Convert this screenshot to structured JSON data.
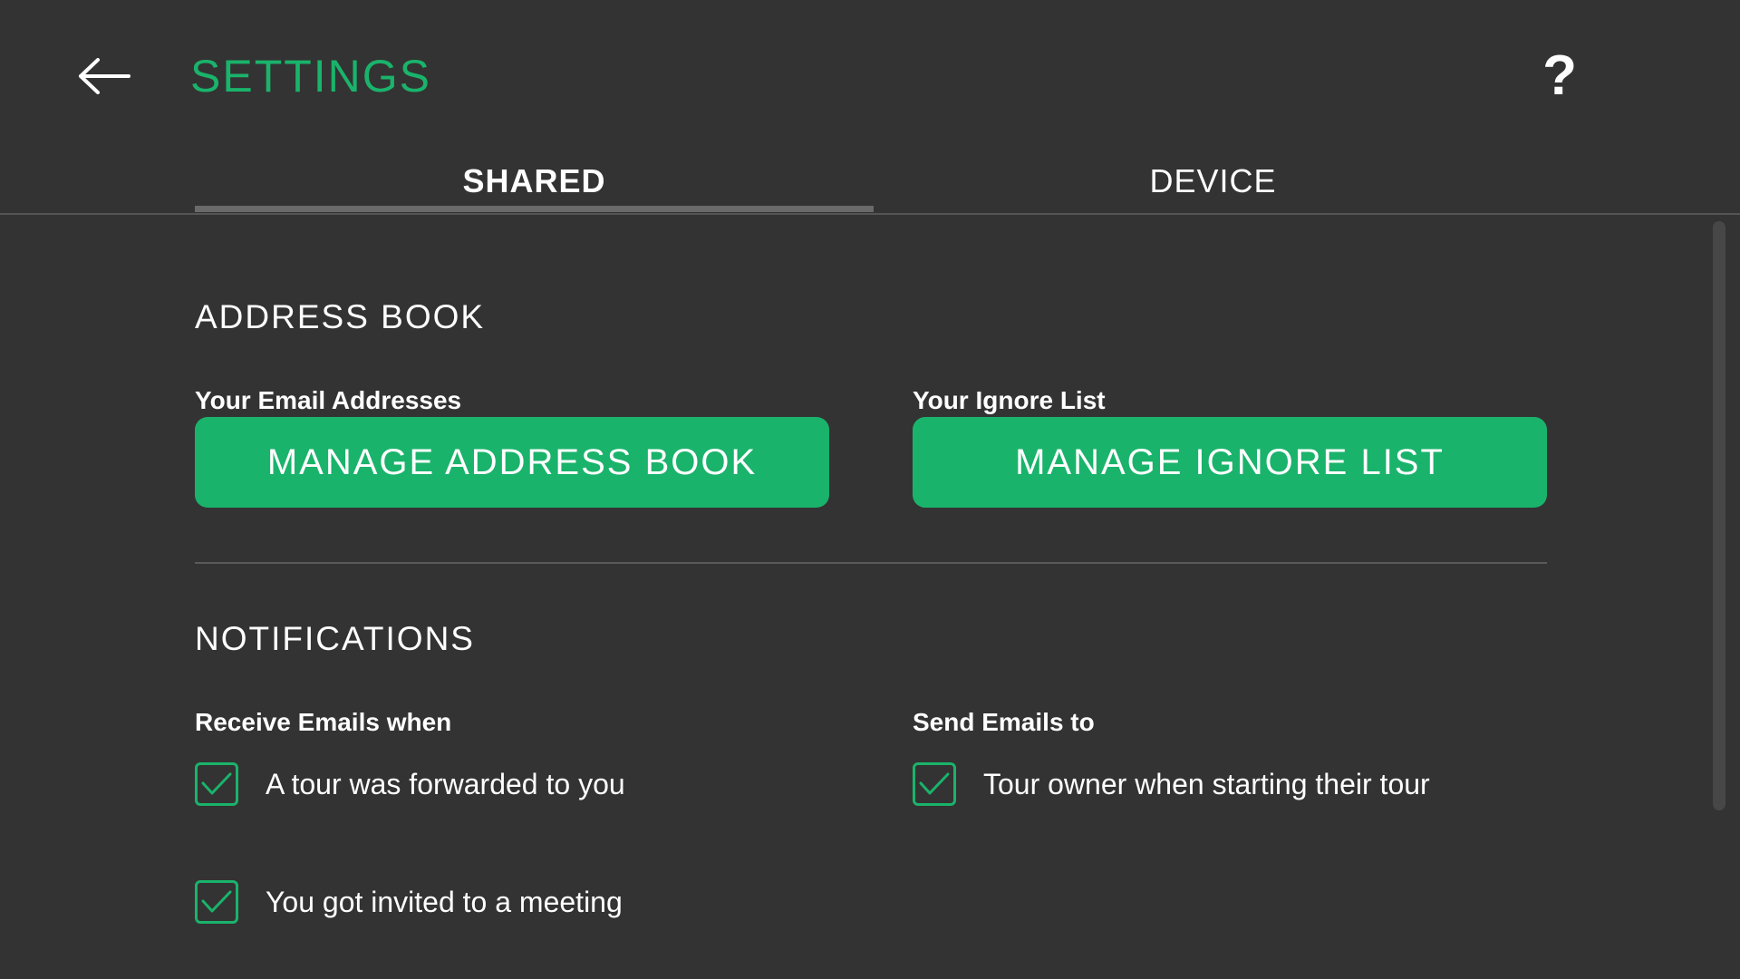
{
  "header": {
    "title": "SETTINGS",
    "help_label": "?",
    "back_icon": "arrow-left-icon"
  },
  "tabs": [
    {
      "label": "SHARED",
      "active": true
    },
    {
      "label": "DEVICE",
      "active": false
    }
  ],
  "address_book": {
    "title": "ADDRESS BOOK",
    "email_label": "Your Email Addresses",
    "email_button": "MANAGE ADDRESS BOOK",
    "ignore_label": "Your Ignore List",
    "ignore_button": "MANAGE IGNORE LIST"
  },
  "notifications": {
    "title": "NOTIFICATIONS",
    "receive": {
      "label": "Receive Emails when",
      "options": [
        {
          "label": "A tour was forwarded to you",
          "checked": true
        },
        {
          "label": "You got invited to a meeting",
          "checked": true
        }
      ]
    },
    "send": {
      "label": "Send Emails to",
      "options": [
        {
          "label": "Tour owner when starting their tour",
          "checked": true
        }
      ]
    }
  },
  "colors": {
    "accent": "#1ab36b",
    "background": "#333333"
  }
}
